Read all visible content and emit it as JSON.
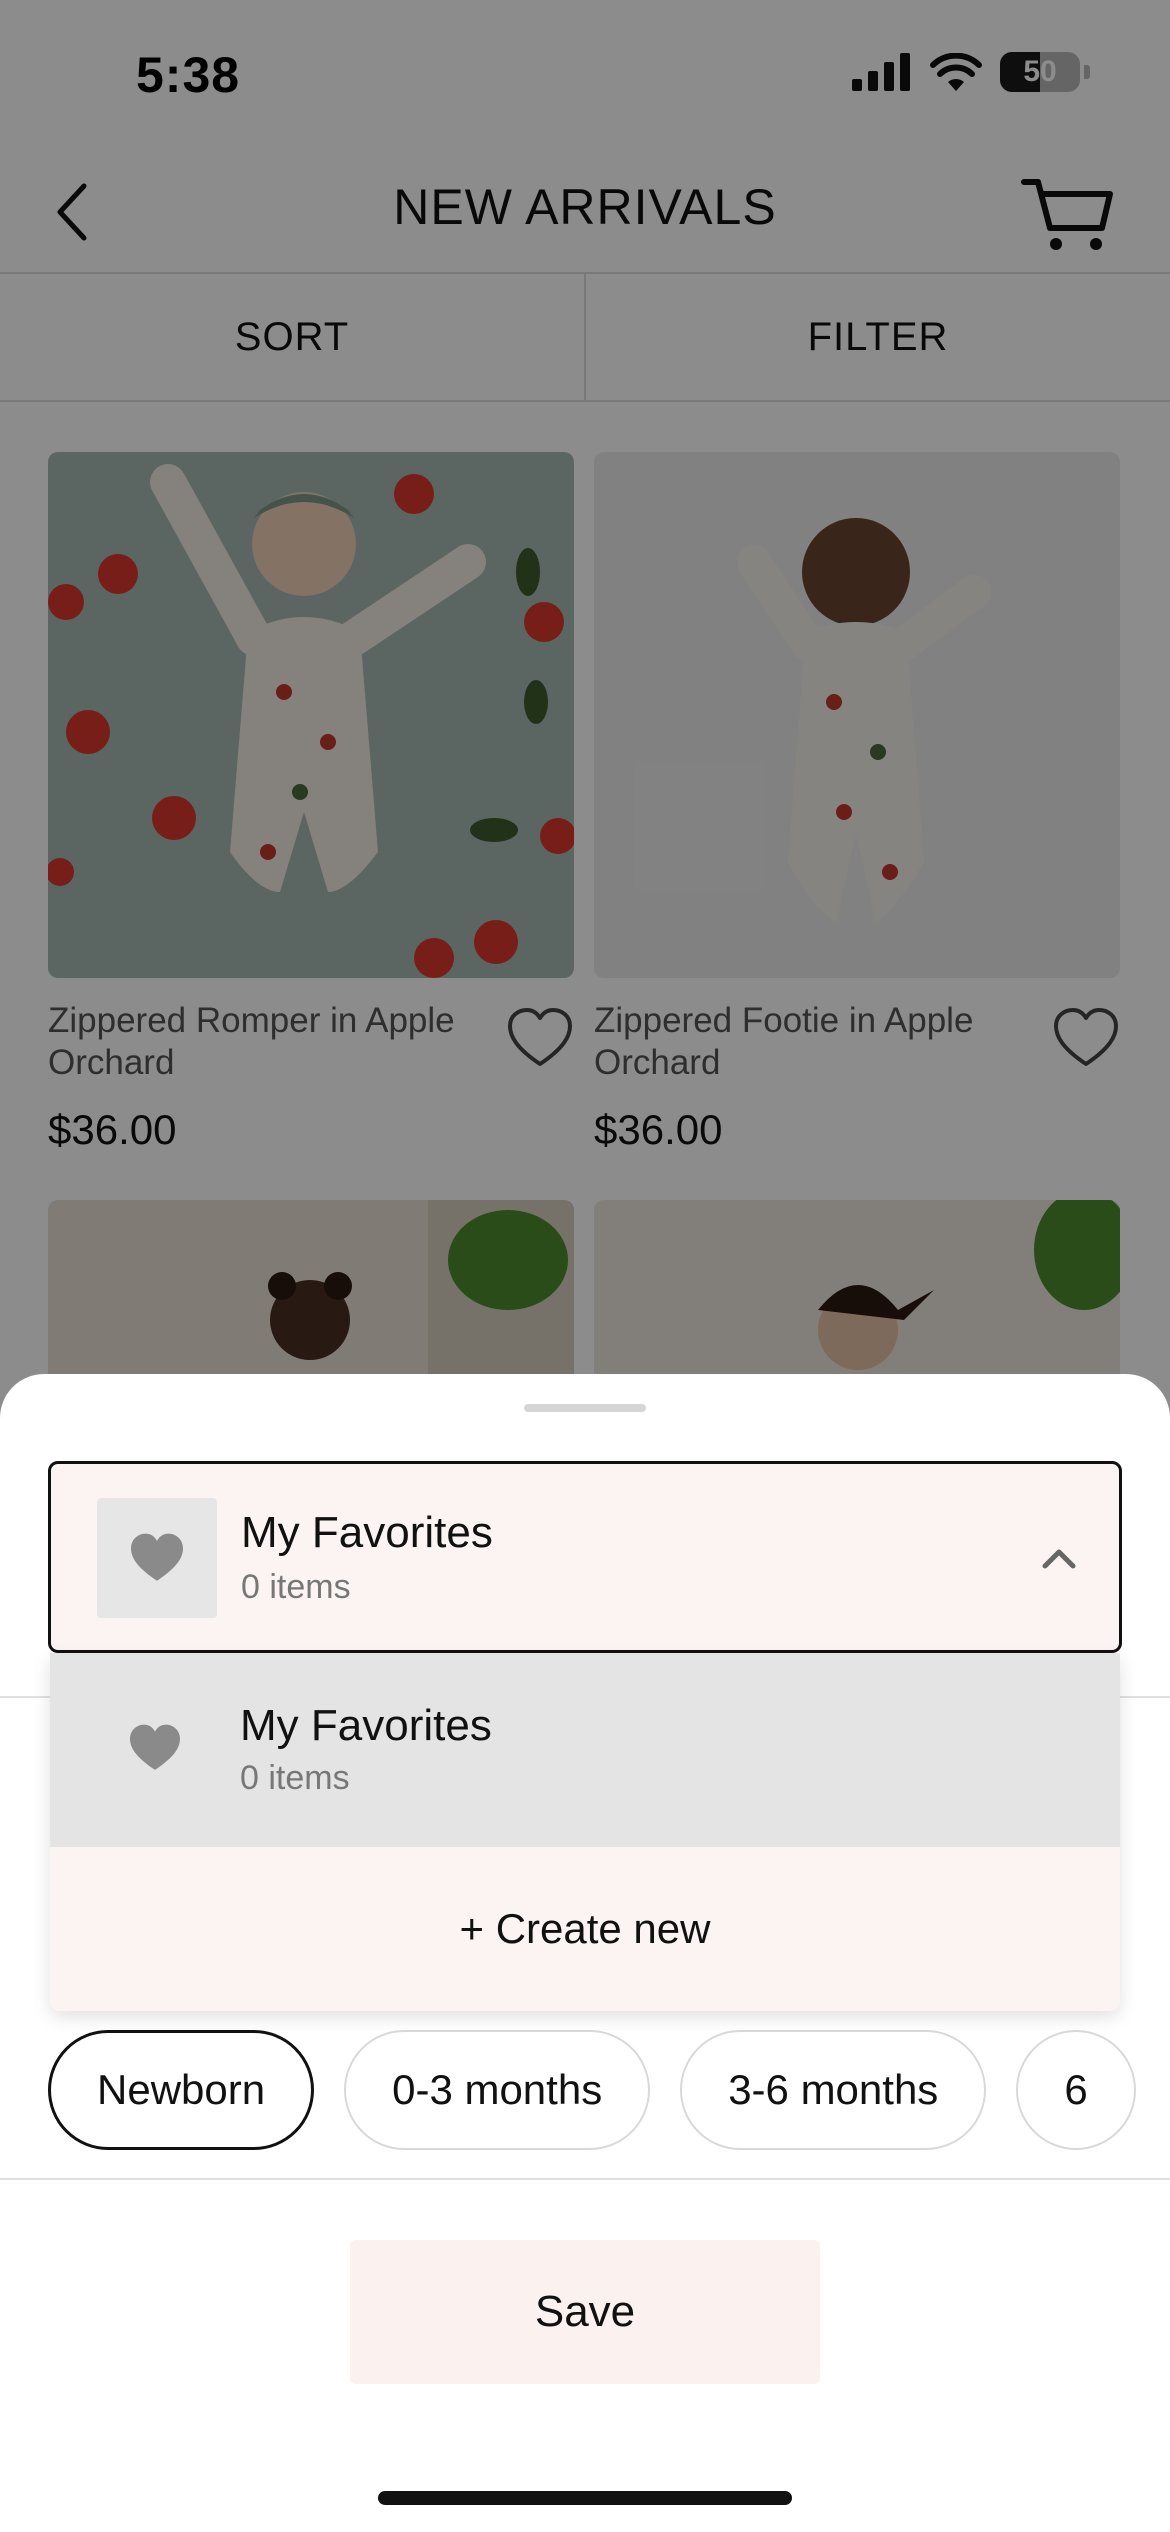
{
  "status_bar": {
    "time": "5:38",
    "battery": "50",
    "battery_level": 0.5
  },
  "nav": {
    "title": "NEW ARRIVALS",
    "back_icon": "chevron-left-icon",
    "cart_icon": "cart-icon"
  },
  "toolbar": {
    "sort_label": "SORT",
    "filter_label": "FILTER"
  },
  "products": [
    {
      "name": "Zippered Romper in Apple Orchard",
      "price": "$36.00"
    },
    {
      "name": "Zippered Footie in Apple Orchard",
      "price": "$36.00"
    }
  ],
  "sheet": {
    "sizes": [
      "Newborn",
      "0-3 months",
      "3-6 months",
      "6"
    ],
    "selected_size": "Newborn",
    "save_label": "Save",
    "dropdown": {
      "selected": {
        "title": "My Favorites",
        "subtitle": "0 items"
      },
      "options": [
        {
          "title": "My Favorites",
          "subtitle": "0 items"
        }
      ],
      "create_label": "+ Create new"
    }
  },
  "colors": {
    "accent_bg": "#fcf4f2",
    "selected_option_bg": "#e4e4e4",
    "text": "#111111"
  }
}
